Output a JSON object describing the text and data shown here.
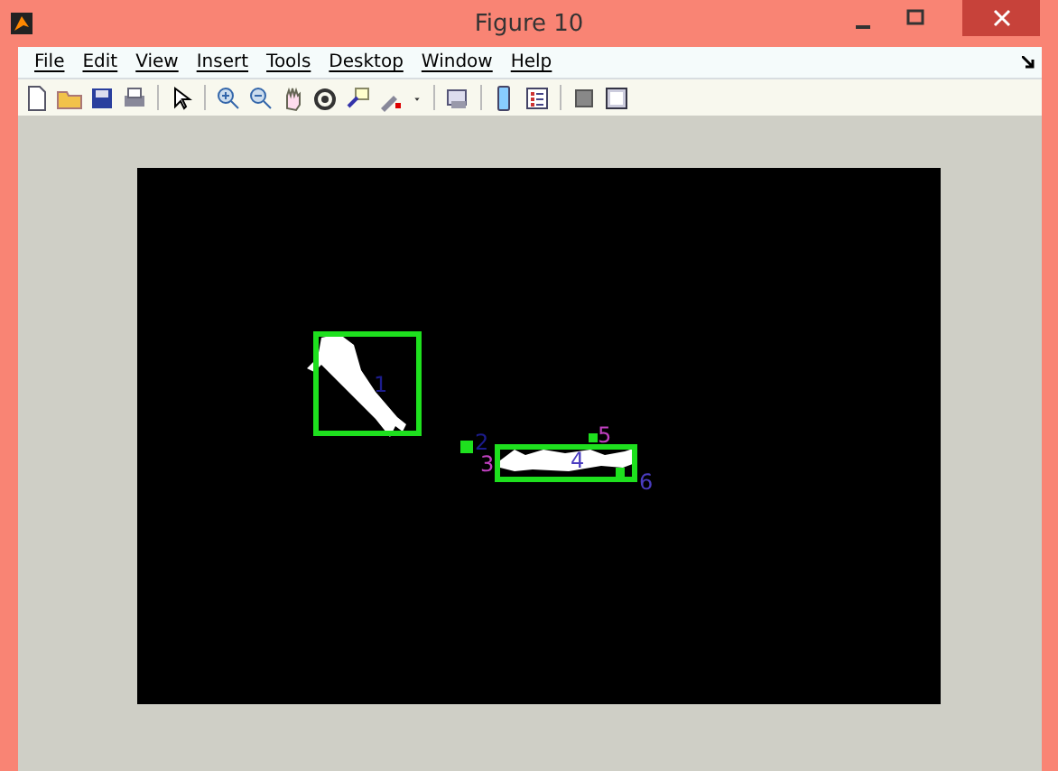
{
  "window": {
    "title": "Figure 10"
  },
  "menu": [
    "File",
    "Edit",
    "View",
    "Insert",
    "Tools",
    "Desktop",
    "Window",
    "Help"
  ],
  "plot": {
    "labels": [
      {
        "text": "1",
        "color": "#1c1c8c"
      },
      {
        "text": "2",
        "color": "#1c1c8c"
      },
      {
        "text": "3",
        "color": "#c040c0"
      },
      {
        "text": "4",
        "color": "#4a3cc0"
      },
      {
        "text": "5",
        "color": "#c040c0"
      },
      {
        "text": "6",
        "color": "#4a3cc0"
      }
    ]
  }
}
